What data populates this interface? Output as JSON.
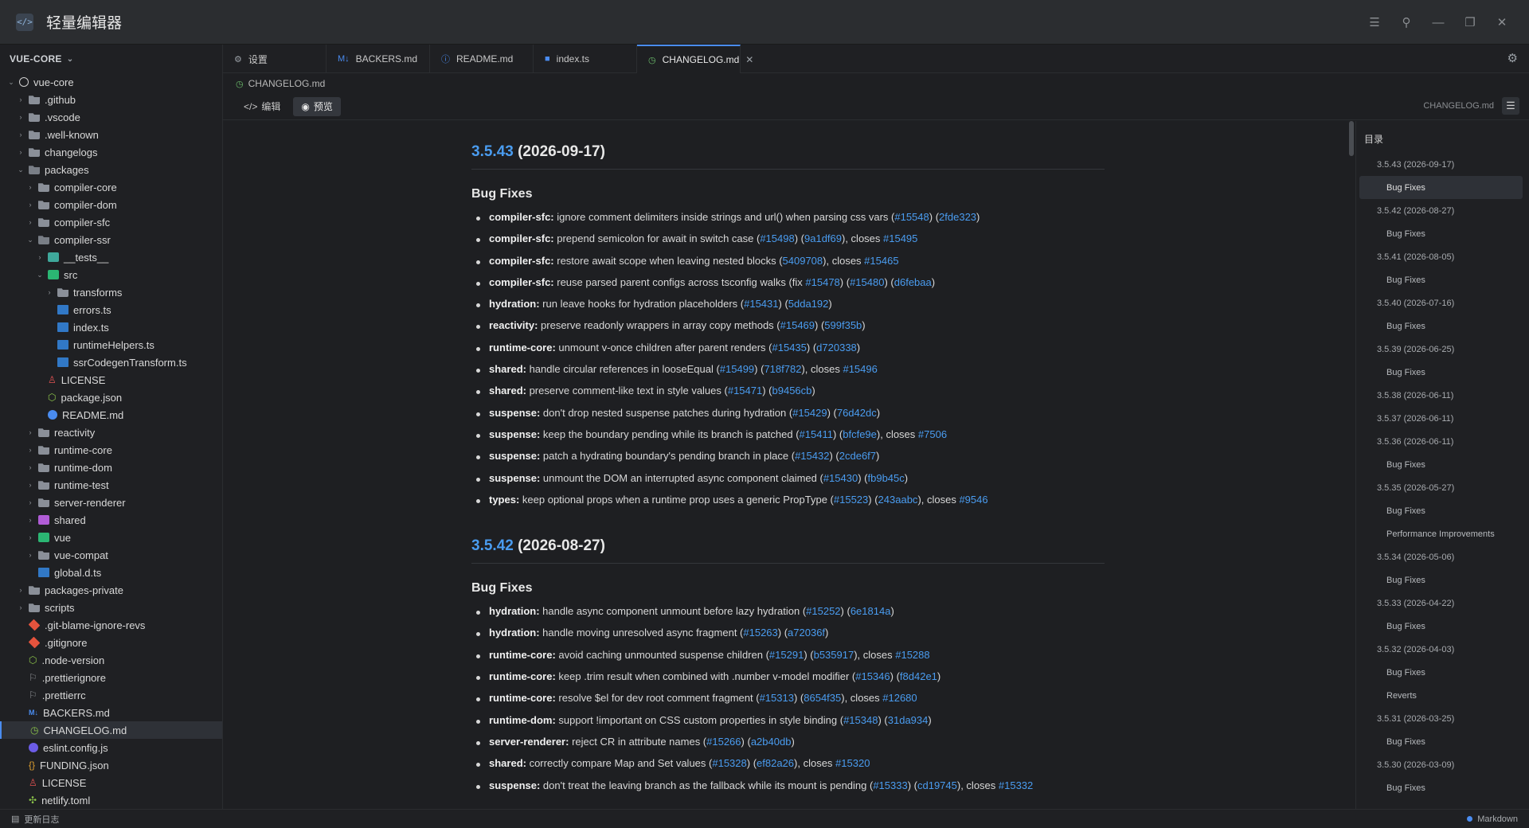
{
  "app": {
    "title": "轻量编辑器",
    "icon": "code-file-icon"
  },
  "window_controls": [
    "menu-icon",
    "pin-icon",
    "minimize-icon",
    "restore-icon",
    "close-icon"
  ],
  "sidebar": {
    "header": "VUE-CORE",
    "tree": [
      {
        "label": "vue-core",
        "depth": 0,
        "chev": "v",
        "icon": "circle"
      },
      {
        "label": ".github",
        "depth": 1,
        "chev": ">",
        "icon": "folder"
      },
      {
        "label": ".vscode",
        "depth": 1,
        "chev": ">",
        "icon": "folder"
      },
      {
        "label": ".well-known",
        "depth": 1,
        "chev": ">",
        "icon": "folder"
      },
      {
        "label": "changelogs",
        "depth": 1,
        "chev": ">",
        "icon": "folder"
      },
      {
        "label": "packages",
        "depth": 1,
        "chev": "v",
        "icon": "folder-open"
      },
      {
        "label": "compiler-core",
        "depth": 2,
        "chev": ">",
        "icon": "folder"
      },
      {
        "label": "compiler-dom",
        "depth": 2,
        "chev": ">",
        "icon": "folder"
      },
      {
        "label": "compiler-sfc",
        "depth": 2,
        "chev": ">",
        "icon": "folder"
      },
      {
        "label": "compiler-ssr",
        "depth": 2,
        "chev": "v",
        "icon": "folder-open"
      },
      {
        "label": "__tests__",
        "depth": 3,
        "chev": ">",
        "icon": "teal"
      },
      {
        "label": "src",
        "depth": 3,
        "chev": "v",
        "icon": "green"
      },
      {
        "label": "transforms",
        "depth": 4,
        "chev": ">",
        "icon": "folder"
      },
      {
        "label": "errors.ts",
        "depth": 4,
        "chev": "",
        "icon": "ts"
      },
      {
        "label": "index.ts",
        "depth": 4,
        "chev": "",
        "icon": "ts"
      },
      {
        "label": "runtimeHelpers.ts",
        "depth": 4,
        "chev": "",
        "icon": "ts"
      },
      {
        "label": "ssrCodegenTransform.ts",
        "depth": 4,
        "chev": "",
        "icon": "ts"
      },
      {
        "label": "LICENSE",
        "depth": 3,
        "chev": "",
        "icon": "license"
      },
      {
        "label": "package.json",
        "depth": 3,
        "chev": "",
        "icon": "json"
      },
      {
        "label": "README.md",
        "depth": 3,
        "chev": "",
        "icon": "info"
      },
      {
        "label": "reactivity",
        "depth": 2,
        "chev": ">",
        "icon": "folder"
      },
      {
        "label": "runtime-core",
        "depth": 2,
        "chev": ">",
        "icon": "folder"
      },
      {
        "label": "runtime-dom",
        "depth": 2,
        "chev": ">",
        "icon": "folder"
      },
      {
        "label": "runtime-test",
        "depth": 2,
        "chev": ">",
        "icon": "folder"
      },
      {
        "label": "server-renderer",
        "depth": 2,
        "chev": ">",
        "icon": "folder"
      },
      {
        "label": "shared",
        "depth": 2,
        "chev": ">",
        "icon": "purple"
      },
      {
        "label": "vue",
        "depth": 2,
        "chev": ">",
        "icon": "green"
      },
      {
        "label": "vue-compat",
        "depth": 2,
        "chev": ">",
        "icon": "folder"
      },
      {
        "label": "global.d.ts",
        "depth": 2,
        "chev": "",
        "icon": "ts"
      },
      {
        "label": "packages-private",
        "depth": 1,
        "chev": ">",
        "icon": "folder"
      },
      {
        "label": "scripts",
        "depth": 1,
        "chev": ">",
        "icon": "folder"
      },
      {
        "label": ".git-blame-ignore-revs",
        "depth": 1,
        "chev": "",
        "icon": "git"
      },
      {
        "label": ".gitignore",
        "depth": 1,
        "chev": "",
        "icon": "git"
      },
      {
        "label": ".node-version",
        "depth": 1,
        "chev": "",
        "icon": "json"
      },
      {
        "label": ".prettierignore",
        "depth": 1,
        "chev": "",
        "icon": "flag"
      },
      {
        "label": ".prettierrc",
        "depth": 1,
        "chev": "",
        "icon": "flag"
      },
      {
        "label": "BACKERS.md",
        "depth": 1,
        "chev": "",
        "icon": "md"
      },
      {
        "label": "CHANGELOG.md",
        "depth": 1,
        "chev": "",
        "icon": "changelog",
        "active": true
      },
      {
        "label": "eslint.config.js",
        "depth": 1,
        "chev": "",
        "icon": "eslint"
      },
      {
        "label": "FUNDING.json",
        "depth": 1,
        "chev": "",
        "icon": "braces"
      },
      {
        "label": "LICENSE",
        "depth": 1,
        "chev": "",
        "icon": "license"
      },
      {
        "label": "netlify.toml",
        "depth": 1,
        "chev": "",
        "icon": "netlify"
      }
    ]
  },
  "tabs": [
    {
      "label": "设置",
      "icon": "gear-icon",
      "glyph": "⚙"
    },
    {
      "label": "BACKERS.md",
      "icon": "markdown-icon",
      "glyph": "M↓"
    },
    {
      "label": "README.md",
      "icon": "info-icon",
      "glyph": "ⓘ"
    },
    {
      "label": "index.ts",
      "icon": "typescript-icon",
      "glyph": "■"
    },
    {
      "label": "CHANGELOG.md",
      "icon": "changelog-icon",
      "glyph": "◷",
      "active": true
    }
  ],
  "breadcrumb": "CHANGELOG.md",
  "toolbar": {
    "edit": "编辑",
    "preview": "预览",
    "filename": "CHANGELOG.md"
  },
  "doc": [
    {
      "version": "3.5.43",
      "date": "(2026-09-17)",
      "sections": [
        {
          "title": "Bug Fixes",
          "items": [
            [
              {
                "b": "compiler-sfc:"
              },
              {
                "t": " ignore comment delimiters inside strings and url() when parsing css vars ("
              },
              {
                "l": "#15548"
              },
              {
                "t": ") ("
              },
              {
                "l": "2fde323"
              },
              {
                "t": ")"
              }
            ],
            [
              {
                "b": "compiler-sfc:"
              },
              {
                "t": " prepend semicolon for await in switch case ("
              },
              {
                "l": "#15498"
              },
              {
                "t": ") ("
              },
              {
                "l": "9a1df69"
              },
              {
                "t": "), closes "
              },
              {
                "l": "#15495"
              }
            ],
            [
              {
                "b": "compiler-sfc:"
              },
              {
                "t": " restore await scope when leaving nested blocks ("
              },
              {
                "l": "5409708"
              },
              {
                "t": "), closes "
              },
              {
                "l": "#15465"
              }
            ],
            [
              {
                "b": "compiler-sfc:"
              },
              {
                "t": " reuse parsed parent configs across tsconfig walks (fix "
              },
              {
                "l": "#15478"
              },
              {
                "t": ") ("
              },
              {
                "l": "#15480"
              },
              {
                "t": ") ("
              },
              {
                "l": "d6febaa"
              },
              {
                "t": ")"
              }
            ],
            [
              {
                "b": "hydration:"
              },
              {
                "t": " run leave hooks for hydration placeholders ("
              },
              {
                "l": "#15431"
              },
              {
                "t": ") ("
              },
              {
                "l": "5dda192"
              },
              {
                "t": ")"
              }
            ],
            [
              {
                "b": "reactivity:"
              },
              {
                "t": " preserve readonly wrappers in array copy methods ("
              },
              {
                "l": "#15469"
              },
              {
                "t": ") ("
              },
              {
                "l": "599f35b"
              },
              {
                "t": ")"
              }
            ],
            [
              {
                "b": "runtime-core:"
              },
              {
                "t": " unmount v-once children after parent renders ("
              },
              {
                "l": "#15435"
              },
              {
                "t": ") ("
              },
              {
                "l": "d720338"
              },
              {
                "t": ")"
              }
            ],
            [
              {
                "b": "shared:"
              },
              {
                "t": " handle circular references in looseEqual ("
              },
              {
                "l": "#15499"
              },
              {
                "t": ") ("
              },
              {
                "l": "718f782"
              },
              {
                "t": "), closes "
              },
              {
                "l": "#15496"
              }
            ],
            [
              {
                "b": "shared:"
              },
              {
                "t": " preserve comment-like text in style values ("
              },
              {
                "l": "#15471"
              },
              {
                "t": ") ("
              },
              {
                "l": "b9456cb"
              },
              {
                "t": ")"
              }
            ],
            [
              {
                "b": "suspense:"
              },
              {
                "t": " don't drop nested suspense patches during hydration ("
              },
              {
                "l": "#15429"
              },
              {
                "t": ") ("
              },
              {
                "l": "76d42dc"
              },
              {
                "t": ")"
              }
            ],
            [
              {
                "b": "suspense:"
              },
              {
                "t": " keep the boundary pending while its branch is patched ("
              },
              {
                "l": "#15411"
              },
              {
                "t": ") ("
              },
              {
                "l": "bfcfe9e"
              },
              {
                "t": "), closes "
              },
              {
                "l": "#7506"
              }
            ],
            [
              {
                "b": "suspense:"
              },
              {
                "t": " patch a hydrating boundary's pending branch in place ("
              },
              {
                "l": "#15432"
              },
              {
                "t": ") ("
              },
              {
                "l": "2cde6f7"
              },
              {
                "t": ")"
              }
            ],
            [
              {
                "b": "suspense:"
              },
              {
                "t": " unmount the DOM an interrupted async component claimed ("
              },
              {
                "l": "#15430"
              },
              {
                "t": ") ("
              },
              {
                "l": "fb9b45c"
              },
              {
                "t": ")"
              }
            ],
            [
              {
                "b": "types:"
              },
              {
                "t": " keep optional props when a runtime prop uses a generic PropType ("
              },
              {
                "l": "#15523"
              },
              {
                "t": ") ("
              },
              {
                "l": "243aabc"
              },
              {
                "t": "), closes "
              },
              {
                "l": "#9546"
              }
            ]
          ]
        }
      ]
    },
    {
      "version": "3.5.42",
      "date": "(2026-08-27)",
      "sections": [
        {
          "title": "Bug Fixes",
          "items": [
            [
              {
                "b": "hydration:"
              },
              {
                "t": " handle async component unmount before lazy hydration ("
              },
              {
                "l": "#15252"
              },
              {
                "t": ") ("
              },
              {
                "l": "6e1814a"
              },
              {
                "t": ")"
              }
            ],
            [
              {
                "b": "hydration:"
              },
              {
                "t": " handle moving unresolved async fragment ("
              },
              {
                "l": "#15263"
              },
              {
                "t": ") ("
              },
              {
                "l": "a72036f"
              },
              {
                "t": ")"
              }
            ],
            [
              {
                "b": "runtime-core:"
              },
              {
                "t": " avoid caching unmounted suspense children ("
              },
              {
                "l": "#15291"
              },
              {
                "t": ") ("
              },
              {
                "l": "b535917"
              },
              {
                "t": "), closes "
              },
              {
                "l": "#15288"
              }
            ],
            [
              {
                "b": "runtime-core:"
              },
              {
                "t": " keep .trim result when combined with .number v-model modifier ("
              },
              {
                "l": "#15346"
              },
              {
                "t": ") ("
              },
              {
                "l": "f8d42e1"
              },
              {
                "t": ")"
              }
            ],
            [
              {
                "b": "runtime-core:"
              },
              {
                "t": " resolve $el for dev root comment fragment ("
              },
              {
                "l": "#15313"
              },
              {
                "t": ") ("
              },
              {
                "l": "8654f35"
              },
              {
                "t": "), closes "
              },
              {
                "l": "#12680"
              }
            ],
            [
              {
                "b": "runtime-dom:"
              },
              {
                "t": " support !important on CSS custom properties in style binding ("
              },
              {
                "l": "#15348"
              },
              {
                "t": ") ("
              },
              {
                "l": "31da934"
              },
              {
                "t": ")"
              }
            ],
            [
              {
                "b": "server-renderer:"
              },
              {
                "t": " reject CR in attribute names ("
              },
              {
                "l": "#15266"
              },
              {
                "t": ") ("
              },
              {
                "l": "a2b40db"
              },
              {
                "t": ")"
              }
            ],
            [
              {
                "b": "shared:"
              },
              {
                "t": " correctly compare Map and Set values ("
              },
              {
                "l": "#15328"
              },
              {
                "t": ") ("
              },
              {
                "l": "ef82a26"
              },
              {
                "t": "), closes "
              },
              {
                "l": "#15320"
              }
            ],
            [
              {
                "b": "suspense:"
              },
              {
                "t": " don't treat the leaving branch as the fallback while its mount is pending ("
              },
              {
                "l": "#15333"
              },
              {
                "t": ") ("
              },
              {
                "l": "cd19745"
              },
              {
                "t": "), closes "
              },
              {
                "l": "#15332"
              }
            ]
          ]
        }
      ]
    }
  ],
  "toc": {
    "title": "目录",
    "items": [
      {
        "label": "3.5.43 (2026-09-17)",
        "level": 1
      },
      {
        "label": "Bug Fixes",
        "level": 2,
        "active": true
      },
      {
        "label": "3.5.42 (2026-08-27)",
        "level": 1
      },
      {
        "label": "Bug Fixes",
        "level": 2
      },
      {
        "label": "3.5.41 (2026-08-05)",
        "level": 1
      },
      {
        "label": "Bug Fixes",
        "level": 2
      },
      {
        "label": "3.5.40 (2026-07-16)",
        "level": 1
      },
      {
        "label": "Bug Fixes",
        "level": 2
      },
      {
        "label": "3.5.39 (2026-06-25)",
        "level": 1
      },
      {
        "label": "Bug Fixes",
        "level": 2
      },
      {
        "label": "3.5.38 (2026-06-11)",
        "level": 1
      },
      {
        "label": "3.5.37 (2026-06-11)",
        "level": 1
      },
      {
        "label": "3.5.36 (2026-06-11)",
        "level": 1
      },
      {
        "label": "Bug Fixes",
        "level": 2
      },
      {
        "label": "3.5.35 (2026-05-27)",
        "level": 1
      },
      {
        "label": "Bug Fixes",
        "level": 2
      },
      {
        "label": "Performance Improvements",
        "level": 2
      },
      {
        "label": "3.5.34 (2026-05-06)",
        "level": 1
      },
      {
        "label": "Bug Fixes",
        "level": 2
      },
      {
        "label": "3.5.33 (2026-04-22)",
        "level": 1
      },
      {
        "label": "Bug Fixes",
        "level": 2
      },
      {
        "label": "3.5.32 (2026-04-03)",
        "level": 1
      },
      {
        "label": "Bug Fixes",
        "level": 2
      },
      {
        "label": "Reverts",
        "level": 2
      },
      {
        "label": "3.5.31 (2026-03-25)",
        "level": 1
      },
      {
        "label": "Bug Fixes",
        "level": 2
      },
      {
        "label": "3.5.30 (2026-03-09)",
        "level": 1
      },
      {
        "label": "Bug Fixes",
        "level": 2
      }
    ]
  },
  "status": {
    "left": "更新日志",
    "right": "Markdown"
  },
  "colors": {
    "accent": "#4a8cf0",
    "link": "#4a9cf0",
    "background": "#1e1f22"
  }
}
